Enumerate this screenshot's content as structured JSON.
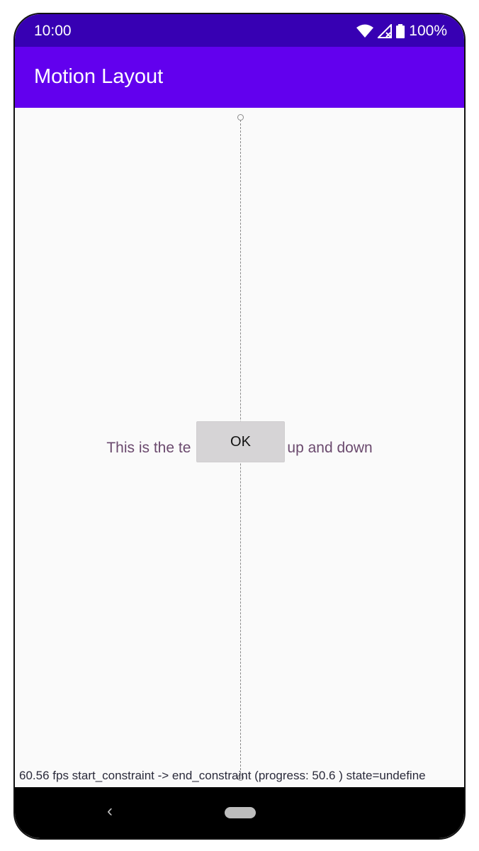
{
  "status_bar": {
    "time": "10:00",
    "battery": "100%",
    "icons": [
      "wifi-icon",
      "signal-icon",
      "battery-icon"
    ]
  },
  "app_bar": {
    "title": "Motion Layout",
    "color": "#6200ee",
    "status_color": "#3700b3"
  },
  "content": {
    "text_left": "This is the te",
    "text_right": "up and down",
    "button_label": "OK"
  },
  "debug": {
    "text": "60.56 fps start_constraint -> end_constraint (progress: 50.6 ) state=undefine"
  },
  "nav_bar": {
    "back_glyph": "‹"
  }
}
